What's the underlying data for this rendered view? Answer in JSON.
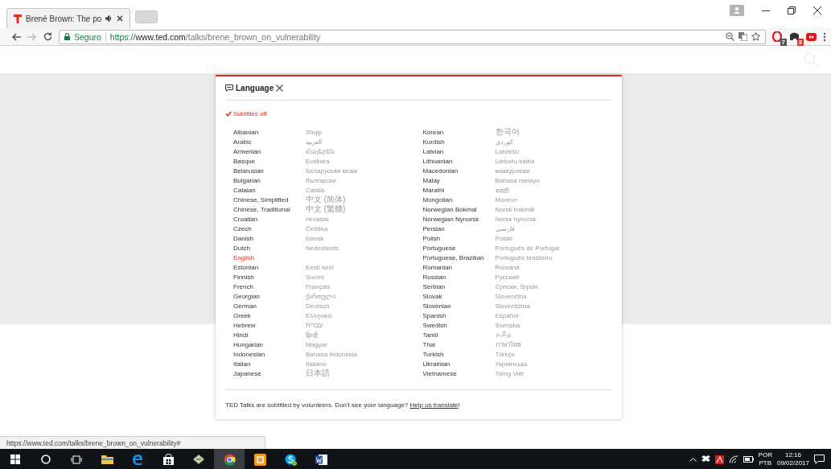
{
  "browser": {
    "tab": {
      "title": "Brené Brown: The po"
    },
    "address": {
      "secure_label": "Seguro",
      "scheme": "https://",
      "host": "www.ted.com",
      "path": "/talks/brene_brown_on_vulnerability"
    },
    "extension_badges": [
      "7",
      "3"
    ]
  },
  "dialog": {
    "title": "Language",
    "subtitles_off": {
      "label": "Subtitles off",
      "selected": true
    },
    "columns": [
      [
        {
          "name": "Albanian",
          "native": "Shqip",
          "selected": false
        },
        {
          "name": "Arabic",
          "native": "العربية",
          "selected": false
        },
        {
          "name": "Armenian",
          "native": "Հայերեն",
          "selected": false
        },
        {
          "name": "Basque",
          "native": "Euskara",
          "selected": false
        },
        {
          "name": "Belarusian",
          "native": "Беларуская мова",
          "selected": false
        },
        {
          "name": "Bulgarian",
          "native": "български",
          "selected": false
        },
        {
          "name": "Catalan",
          "native": "Català",
          "selected": false
        },
        {
          "name": "Chinese, Simplified",
          "native": "中文 (简体)",
          "kind": "cjk",
          "selected": false
        },
        {
          "name": "Chinese, Traditional",
          "native": "中文 (繁體)",
          "kind": "cjk",
          "selected": false
        },
        {
          "name": "Croatian",
          "native": "Hrvatski",
          "selected": false
        },
        {
          "name": "Czech",
          "native": "Čeština",
          "selected": false
        },
        {
          "name": "Danish",
          "native": "Dansk",
          "selected": false
        },
        {
          "name": "Dutch",
          "native": "Nederlands",
          "selected": false
        },
        {
          "name": "English",
          "selected": true
        },
        {
          "name": "Estonian",
          "native": "Eesti keel",
          "selected": false
        },
        {
          "name": "Finnish",
          "native": "Suomi",
          "selected": false
        },
        {
          "name": "French",
          "native": "Français",
          "selected": false
        },
        {
          "name": "Georgian",
          "native": "ქართული",
          "selected": false
        },
        {
          "name": "German",
          "native": "Deutsch",
          "selected": false
        },
        {
          "name": "Greek",
          "native": "Ελληνικά",
          "selected": false
        },
        {
          "name": "Hebrew",
          "native": "עברית",
          "selected": false
        },
        {
          "name": "Hindi",
          "native": "हिन्दी",
          "selected": false
        },
        {
          "name": "Hungarian",
          "native": "Magyar",
          "selected": false
        },
        {
          "name": "Indonesian",
          "native": "Bahasa Indonesia",
          "selected": false
        },
        {
          "name": "Italian",
          "native": "Italiano",
          "selected": false
        },
        {
          "name": "Japanese",
          "native": "日本語",
          "kind": "cjk",
          "selected": false
        }
      ],
      [
        {
          "name": "Korean",
          "native": "한국어",
          "kind": "cjk",
          "selected": false
        },
        {
          "name": "Kurdish",
          "native": "کوردی",
          "selected": false
        },
        {
          "name": "Latvian",
          "native": "Latviešu",
          "selected": false
        },
        {
          "name": "Lithuanian",
          "native": "Lietuvių kalba",
          "selected": false
        },
        {
          "name": "Macedonian",
          "native": "македонски",
          "selected": false
        },
        {
          "name": "Malay",
          "native": "Bahasa melayu",
          "selected": false
        },
        {
          "name": "Marathi",
          "native": "मराठी",
          "selected": false
        },
        {
          "name": "Mongolian",
          "native": "Монгол",
          "selected": false
        },
        {
          "name": "Norwegian Bokmal",
          "native": "Norsk bokmål",
          "selected": false
        },
        {
          "name": "Norwegian Nynorsk",
          "native": "Norsk nynorsk",
          "selected": false
        },
        {
          "name": "Persian",
          "native": "فارسی",
          "selected": false
        },
        {
          "name": "Polish",
          "native": "Polski",
          "selected": false
        },
        {
          "name": "Portuguese",
          "native": "Português de Portugal",
          "selected": false
        },
        {
          "name": "Portuguese, Brazilian",
          "native": "Português brasileiro",
          "selected": false
        },
        {
          "name": "Romanian",
          "native": "Română",
          "selected": false
        },
        {
          "name": "Russian",
          "native": "Русский",
          "selected": false
        },
        {
          "name": "Serbian",
          "native": "Српски, Srpski",
          "selected": false
        },
        {
          "name": "Slovak",
          "native": "Slovenčina",
          "selected": false
        },
        {
          "name": "Slovenian",
          "native": "Slovenščina",
          "selected": false
        },
        {
          "name": "Spanish",
          "native": "Español",
          "selected": false
        },
        {
          "name": "Swedish",
          "native": "Svenska",
          "selected": false
        },
        {
          "name": "Tamil",
          "native": "தமிழ்",
          "selected": false
        },
        {
          "name": "Thai",
          "native": "ภาษาไทย",
          "selected": false
        },
        {
          "name": "Turkish",
          "native": "Türkçe",
          "selected": false
        },
        {
          "name": "Ukrainian",
          "native": "Українська",
          "selected": false
        },
        {
          "name": "Vietnamese",
          "native": "Tiếng Việt",
          "selected": false
        }
      ]
    ],
    "footer": {
      "text": "TED Talks are subtitled by volunteers. Don't see your language? ",
      "link": "Help us translate",
      "after": "!"
    }
  },
  "status_url": "https://www.ted.com/talks/brene_brown_on_vulnerability#",
  "taskbar": {
    "language": "POR",
    "layout": "PTB",
    "time": "12:16",
    "date": "09/02/2017"
  }
}
